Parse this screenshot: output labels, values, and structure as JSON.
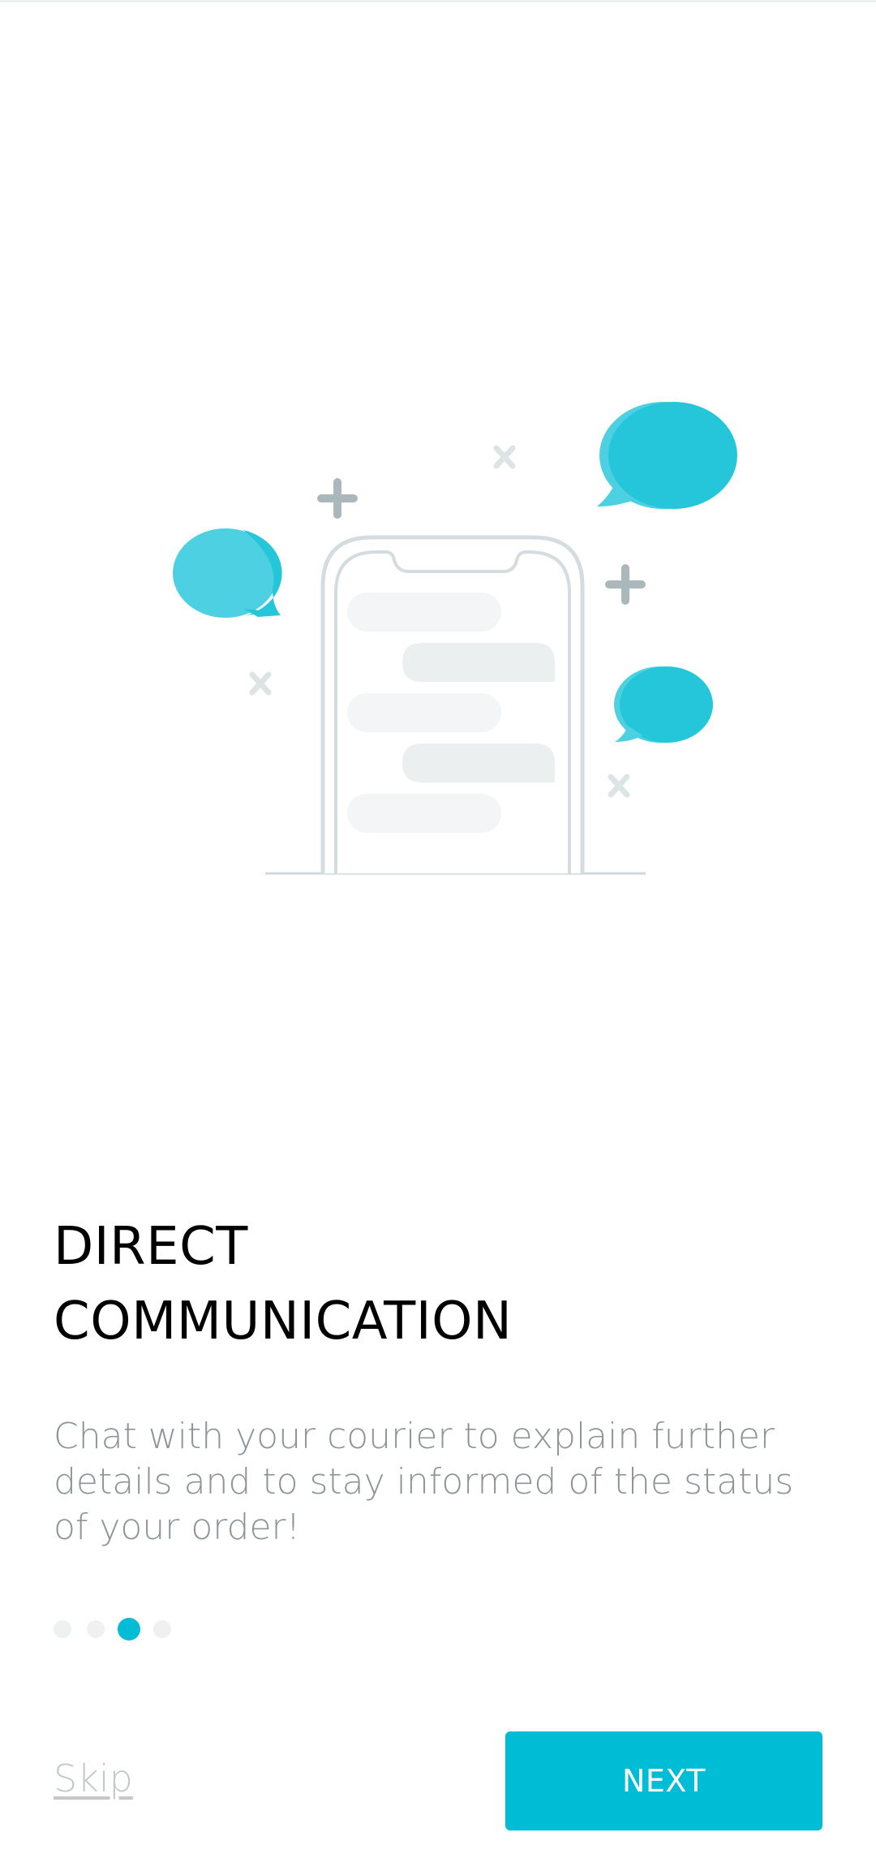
{
  "onboarding": {
    "title_line1": "DIRECT",
    "title_line2": "COMMUNICATION",
    "description": "Chat with your courier to explain further details and to stay informed of the status of your order!",
    "pager": {
      "total_pages": 4,
      "current_page": 3
    },
    "skip_label": "Skip",
    "next_label": "NEXT"
  },
  "colors": {
    "accent": "#00bcd4",
    "bubble_light": "#4dd0e1",
    "title": "#000000",
    "description": "#8e9497",
    "skip": "#c3c8cb"
  },
  "illustration": {
    "icons": [
      "phone-outline-icon",
      "chat-bubble-icon",
      "plus-sparkle-icon",
      "x-sparkle-icon"
    ]
  }
}
